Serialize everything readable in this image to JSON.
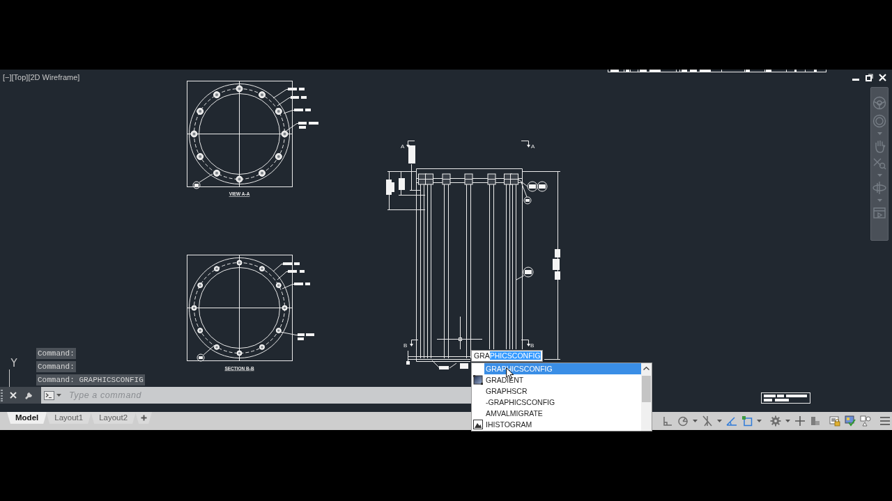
{
  "viewport": {
    "controls": [
      {
        "label": "[−]"
      },
      {
        "label": "[Top]"
      },
      {
        "label": "[2D Wireframe]"
      }
    ]
  },
  "drawing": {
    "view_titles": [
      "VIEW A-A",
      "SECTION B-B"
    ],
    "section_letters": [
      "A",
      "A",
      "B",
      "B"
    ],
    "ucs_label": "Y"
  },
  "command_history": [
    "Command:",
    "Command:",
    "Command: GRAPHICSCONFIG"
  ],
  "command_line": {
    "placeholder": "Type a command"
  },
  "dynamic_input": {
    "typed": "GRA",
    "completion": "PHICSCONFIG"
  },
  "autocomplete": {
    "items": [
      {
        "label": "GRAPHICSCONFIG",
        "kind": "plain",
        "selected": true
      },
      {
        "label": "GRADIENT",
        "kind": "hatch",
        "selected": false
      },
      {
        "label": "GRAPHSCR",
        "kind": "plain",
        "selected": false
      },
      {
        "label": "-GRAPHICSCONFIG",
        "kind": "plain",
        "selected": false
      },
      {
        "label": "AMVALMIGRATE",
        "kind": "plain",
        "selected": false
      },
      {
        "label": "IHISTOGRAM",
        "kind": "raster",
        "selected": false
      }
    ]
  },
  "layout_tabs": [
    {
      "label": "Model",
      "selected": true
    },
    {
      "label": "Layout1",
      "selected": false
    },
    {
      "label": "Layout2",
      "selected": false
    }
  ],
  "status_bar": {
    "toggles": [
      {
        "on": false
      },
      {
        "on": false
      },
      {
        "on": false
      },
      {
        "on": true
      },
      {
        "on": true
      }
    ]
  }
}
